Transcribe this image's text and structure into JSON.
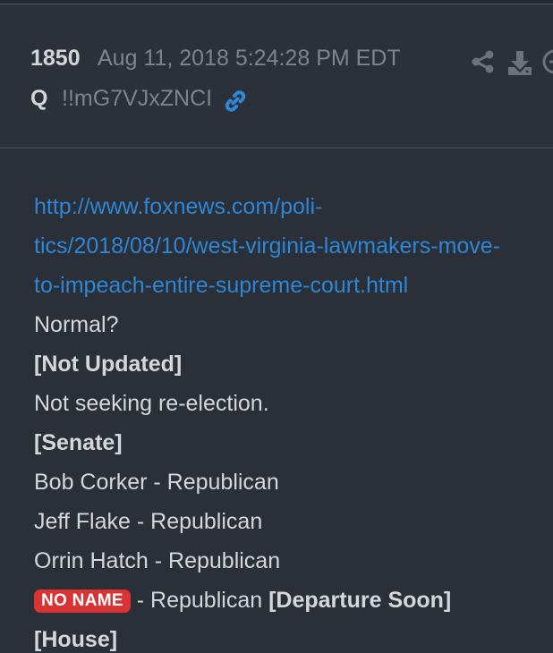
{
  "post": {
    "number": "1850",
    "date": "Aug 11, 2018 5:24:28 PM EDT",
    "author": "Q",
    "tripcode": "!!mG7VJxZNCI"
  },
  "icons": {
    "link": "link-icon",
    "share": "share-icon",
    "download": "download-icon",
    "more": "more-icon"
  },
  "content": {
    "url_line1": "http://www.foxnews.com/poli-",
    "url_line2": "tics/2018/08/10/west-virginia-lawmakers-move-",
    "url_line3": "to-impeach-entire-supreme-court.html",
    "normal": "Normal?",
    "not_updated": "[Not Updated]",
    "not_seeking": "Not seeking re-election.",
    "senate": "[Senate]",
    "corker": "Bob Corker - Republican",
    "flake": "Jeff Flake - Republican",
    "hatch": "Orrin Hatch - Republican",
    "no_name_badge": "NO NAME",
    "no_name_suffix": " - Republican ",
    "departure": "[Departure Soon]",
    "house": "[House]"
  },
  "colors": {
    "background": "#2a2f38",
    "link": "#2e86d6",
    "text": "#d6d7da",
    "muted": "#7f848c",
    "badge": "#d93333"
  }
}
